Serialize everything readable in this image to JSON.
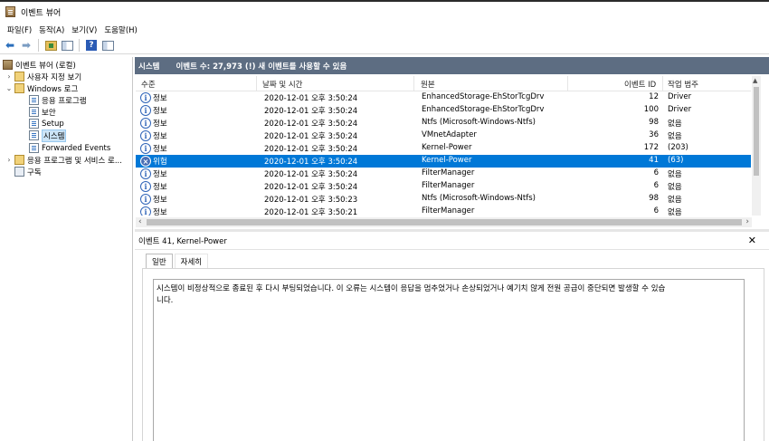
{
  "window": {
    "title": "이벤트 뷰어"
  },
  "menu": [
    "파일(F)",
    "동작(A)",
    "보기(V)",
    "도움말(H)"
  ],
  "tree": {
    "root": "이벤트 뷰어 (로컬)",
    "custom_views": "사용자 지정 보기",
    "windows_logs": "Windows 로그",
    "logs": [
      "응용 프로그램",
      "보안",
      "Setup",
      "시스템",
      "Forwarded Events"
    ],
    "apps_services": "응용 프로그램 및 서비스 로...",
    "subscriptions": "구독"
  },
  "events_header": {
    "log_name": "시스템",
    "count_text": "이벤트 수: 27,973 (!) 새 이벤트를 사용할 수 있음"
  },
  "columns": {
    "level": "수준",
    "datetime": "날짜 및 시간",
    "source": "원본",
    "event_id": "이벤트 ID",
    "category": "작업 범주"
  },
  "rows": [
    {
      "icon": "info-icon",
      "level": "정보",
      "datetime": "2020-12-01 오후 3:50:24",
      "source": "EnhancedStorage-EhStorTcgDrv",
      "event_id": "12",
      "category": "Driver"
    },
    {
      "icon": "info-icon",
      "level": "정보",
      "datetime": "2020-12-01 오후 3:50:24",
      "source": "EnhancedStorage-EhStorTcgDrv",
      "event_id": "100",
      "category": "Driver"
    },
    {
      "icon": "info-icon",
      "level": "정보",
      "datetime": "2020-12-01 오후 3:50:24",
      "source": "Ntfs (Microsoft-Windows-Ntfs)",
      "event_id": "98",
      "category": "없음"
    },
    {
      "icon": "info-icon",
      "level": "정보",
      "datetime": "2020-12-01 오후 3:50:24",
      "source": "VMnetAdapter",
      "event_id": "36",
      "category": "없음"
    },
    {
      "icon": "info-icon",
      "level": "정보",
      "datetime": "2020-12-01 오후 3:50:24",
      "source": "Kernel-Power",
      "event_id": "172",
      "category": "(203)"
    },
    {
      "icon": "critical-icon",
      "level": "위험",
      "datetime": "2020-12-01 오후 3:50:24",
      "source": "Kernel-Power",
      "event_id": "41",
      "category": "(63)",
      "selected": true
    },
    {
      "icon": "info-icon",
      "level": "정보",
      "datetime": "2020-12-01 오후 3:50:24",
      "source": "FilterManager",
      "event_id": "6",
      "category": "없음"
    },
    {
      "icon": "info-icon",
      "level": "정보",
      "datetime": "2020-12-01 오후 3:50:24",
      "source": "FilterManager",
      "event_id": "6",
      "category": "없음"
    },
    {
      "icon": "info-icon",
      "level": "정보",
      "datetime": "2020-12-01 오후 3:50:23",
      "source": "Ntfs (Microsoft-Windows-Ntfs)",
      "event_id": "98",
      "category": "없음"
    },
    {
      "icon": "info-icon",
      "level": "정보",
      "datetime": "2020-12-01 오후 3:50:21",
      "source": "FilterManager",
      "event_id": "6",
      "category": "없음"
    }
  ],
  "detail": {
    "title": "이벤트 41, Kernel-Power",
    "tabs": [
      "일반",
      "자세히"
    ],
    "message_line1": "시스템이 비정상적으로 종료된 후 다시 부팅되었습니다. 이 오류는 시스템이 응답을 멈추었거나 손상되었거나 예기치 않게 전원 공급이 중단되면 발생할 수 있습",
    "message_line2": "니다."
  },
  "colors": {
    "header_band": "#5d6d82",
    "selection": "#0078d7"
  }
}
